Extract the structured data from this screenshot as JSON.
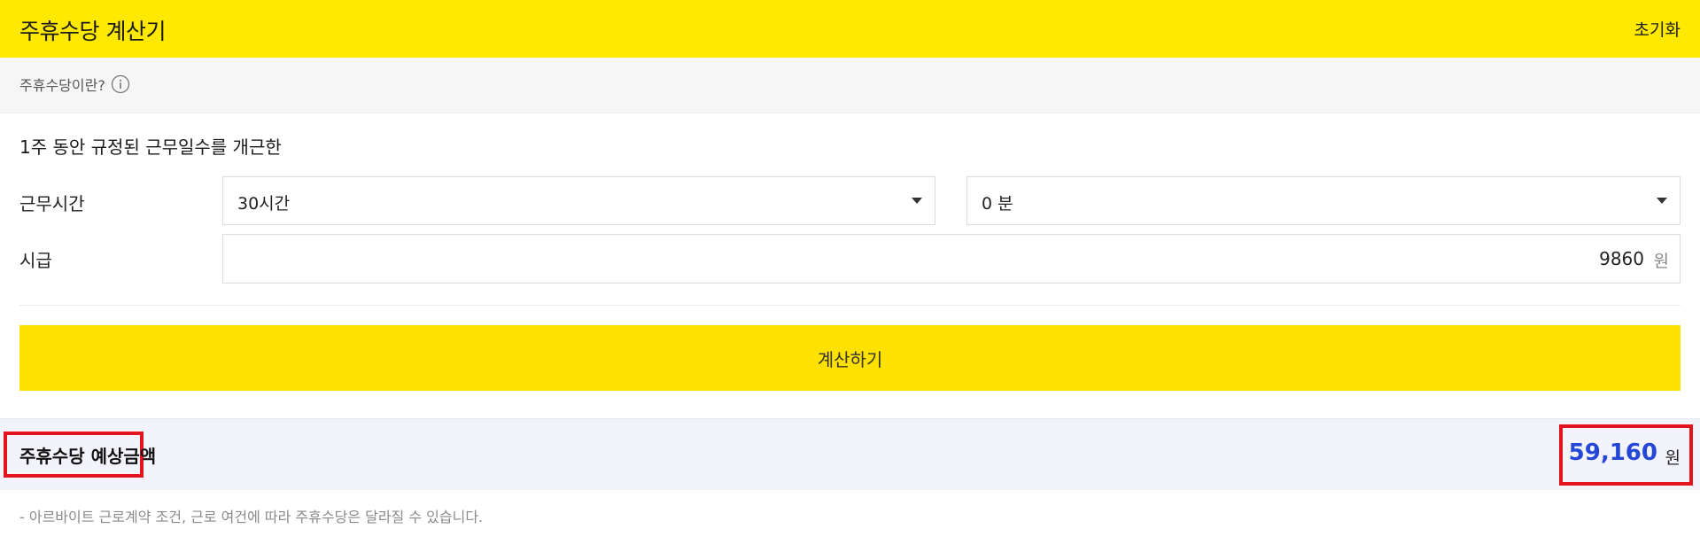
{
  "header": {
    "title": "주휴수당 계산기",
    "reset_label": "초기화"
  },
  "info": {
    "text": "주휴수당이란?",
    "icon": "info-icon"
  },
  "form": {
    "heading": "1주 동안 규정된 근무일수를 개근한",
    "work_time": {
      "label": "근무시간",
      "hours_selected": "30시간",
      "minutes_selected": "0 분"
    },
    "hourly_wage": {
      "label": "시급",
      "value": "9860",
      "unit": "원"
    },
    "calculate_label": "계산하기"
  },
  "result": {
    "label": "주휴수당 예상금액",
    "amount": "59,160",
    "unit": "원",
    "amount_color": "#2447d6",
    "highlight_color": "#e3141c"
  },
  "notice": "- 아르바이트 근로계약 조건, 근로 여건에 따라 주휴수당은 달라질 수 있습니다.",
  "colors": {
    "brand_yellow": "#ffe900",
    "button_yellow": "#ffe100"
  }
}
